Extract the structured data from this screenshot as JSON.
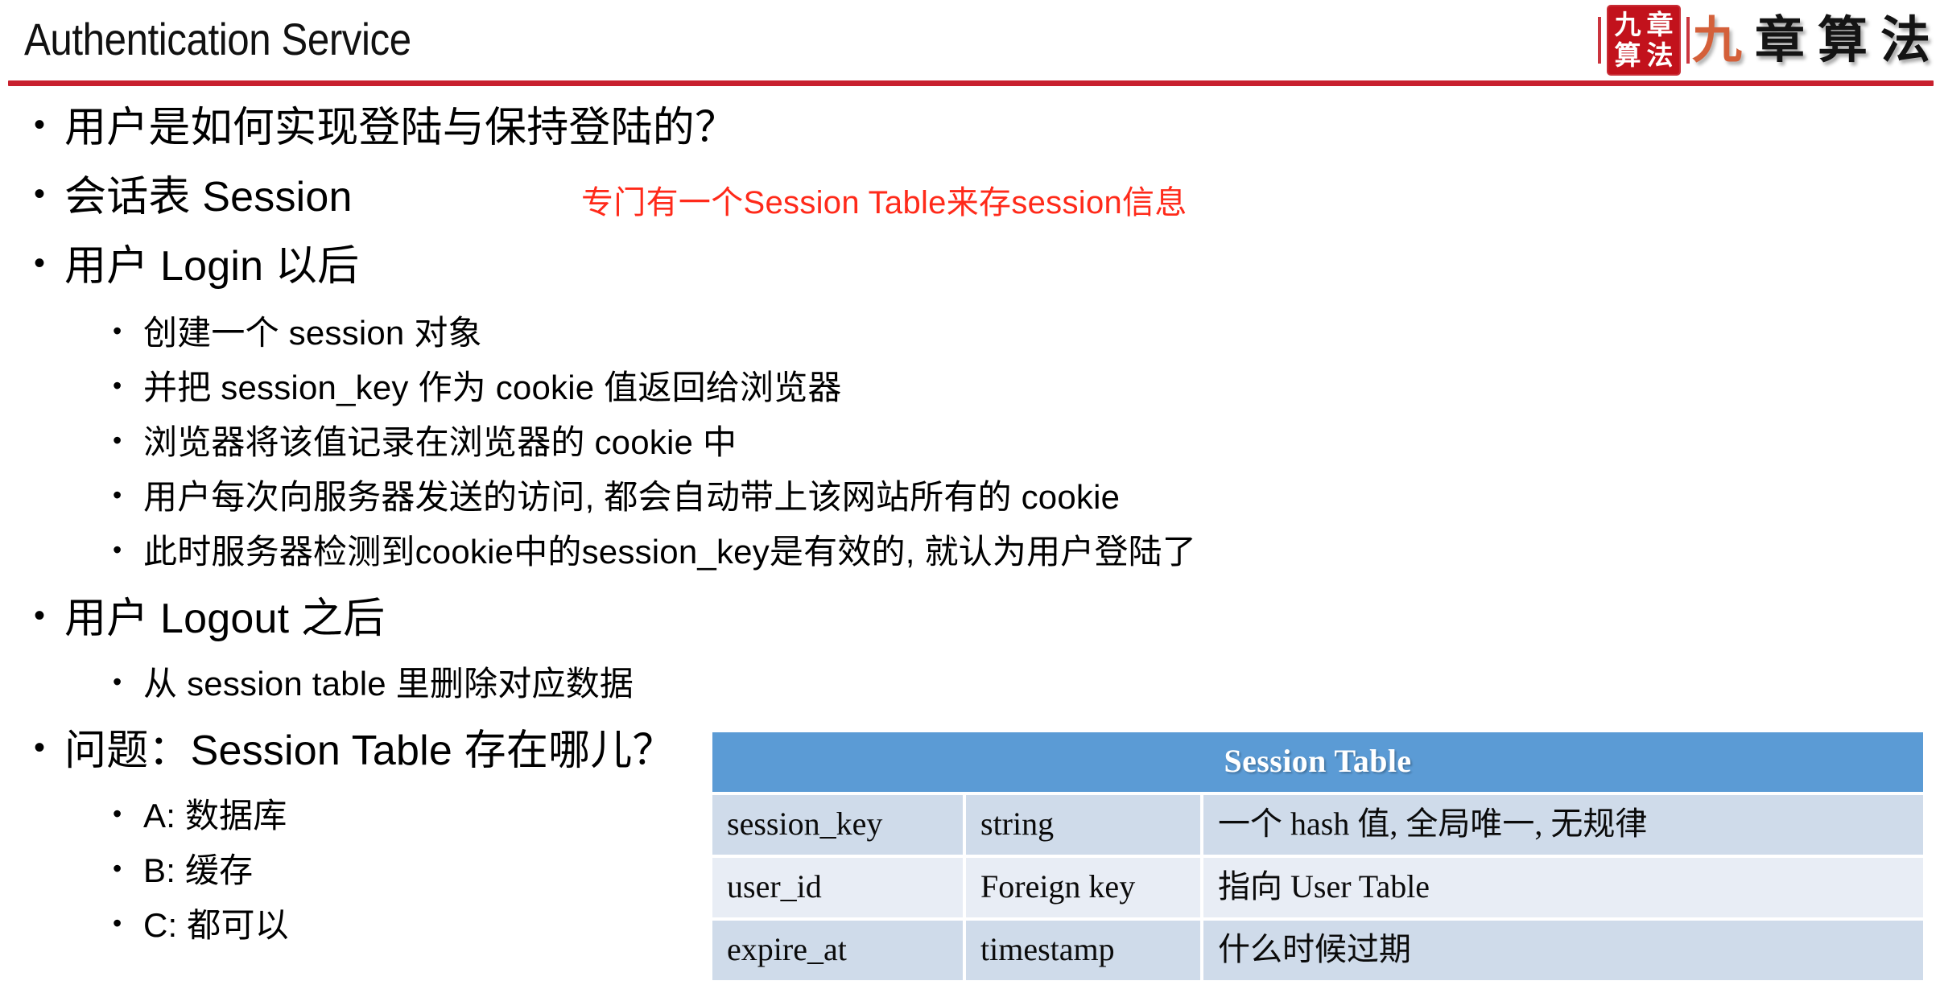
{
  "header": {
    "title": "Authentication Service",
    "rule_color": "#C8202E",
    "logo": {
      "seal_chars": [
        "九",
        "章",
        "算",
        "法"
      ],
      "wordmark": [
        "九",
        "章",
        "算",
        "法"
      ],
      "seal_bg": "#C2121C",
      "accent_color": "#D4603A"
    }
  },
  "content": {
    "bullets": [
      {
        "level": 1,
        "text": "用户是如何实现登陆与保持登陆的？"
      },
      {
        "level": 1,
        "text": "会话表 Session"
      },
      {
        "level": 1,
        "text": "用户 Login 以后"
      },
      {
        "level": 2,
        "text": "创建一个 session 对象"
      },
      {
        "level": 2,
        "text": "并把 session_key 作为 cookie 值返回给浏览器"
      },
      {
        "level": 2,
        "text": "浏览器将该值记录在浏览器的 cookie 中"
      },
      {
        "level": 2,
        "text": "用户每次向服务器发送的访问, 都会自动带上该网站所有的 cookie"
      },
      {
        "level": 2,
        "text": "此时服务器检测到cookie中的session_key是有效的, 就认为用户登陆了"
      },
      {
        "level": 1,
        "text": "用户 Logout 之后"
      },
      {
        "level": 2,
        "text": "从 session table 里删除对应数据"
      },
      {
        "level": 1,
        "text": "问题：Session Table 存在哪儿？"
      },
      {
        "level": 2,
        "text": "A: 数据库"
      },
      {
        "level": 2,
        "text": "B: 缓存"
      },
      {
        "level": 2,
        "text": "C: 都可以"
      }
    ],
    "annotation": {
      "text": "专门有一个Session Table来存session信息",
      "color": "#FF2A1A"
    }
  },
  "session_table": {
    "title": "Session Table",
    "header_bg": "#5B9BD5",
    "row_bg_odd": "#CFDBEA",
    "row_bg_even": "#E8EDF5",
    "rows": [
      {
        "field": "session_key",
        "type": "string",
        "description": "一个 hash 值, 全局唯一, 无规律"
      },
      {
        "field": "user_id",
        "type": "Foreign key",
        "description": "指向 User Table"
      },
      {
        "field": "expire_at",
        "type": "timestamp",
        "description": "什么时候过期"
      }
    ]
  }
}
